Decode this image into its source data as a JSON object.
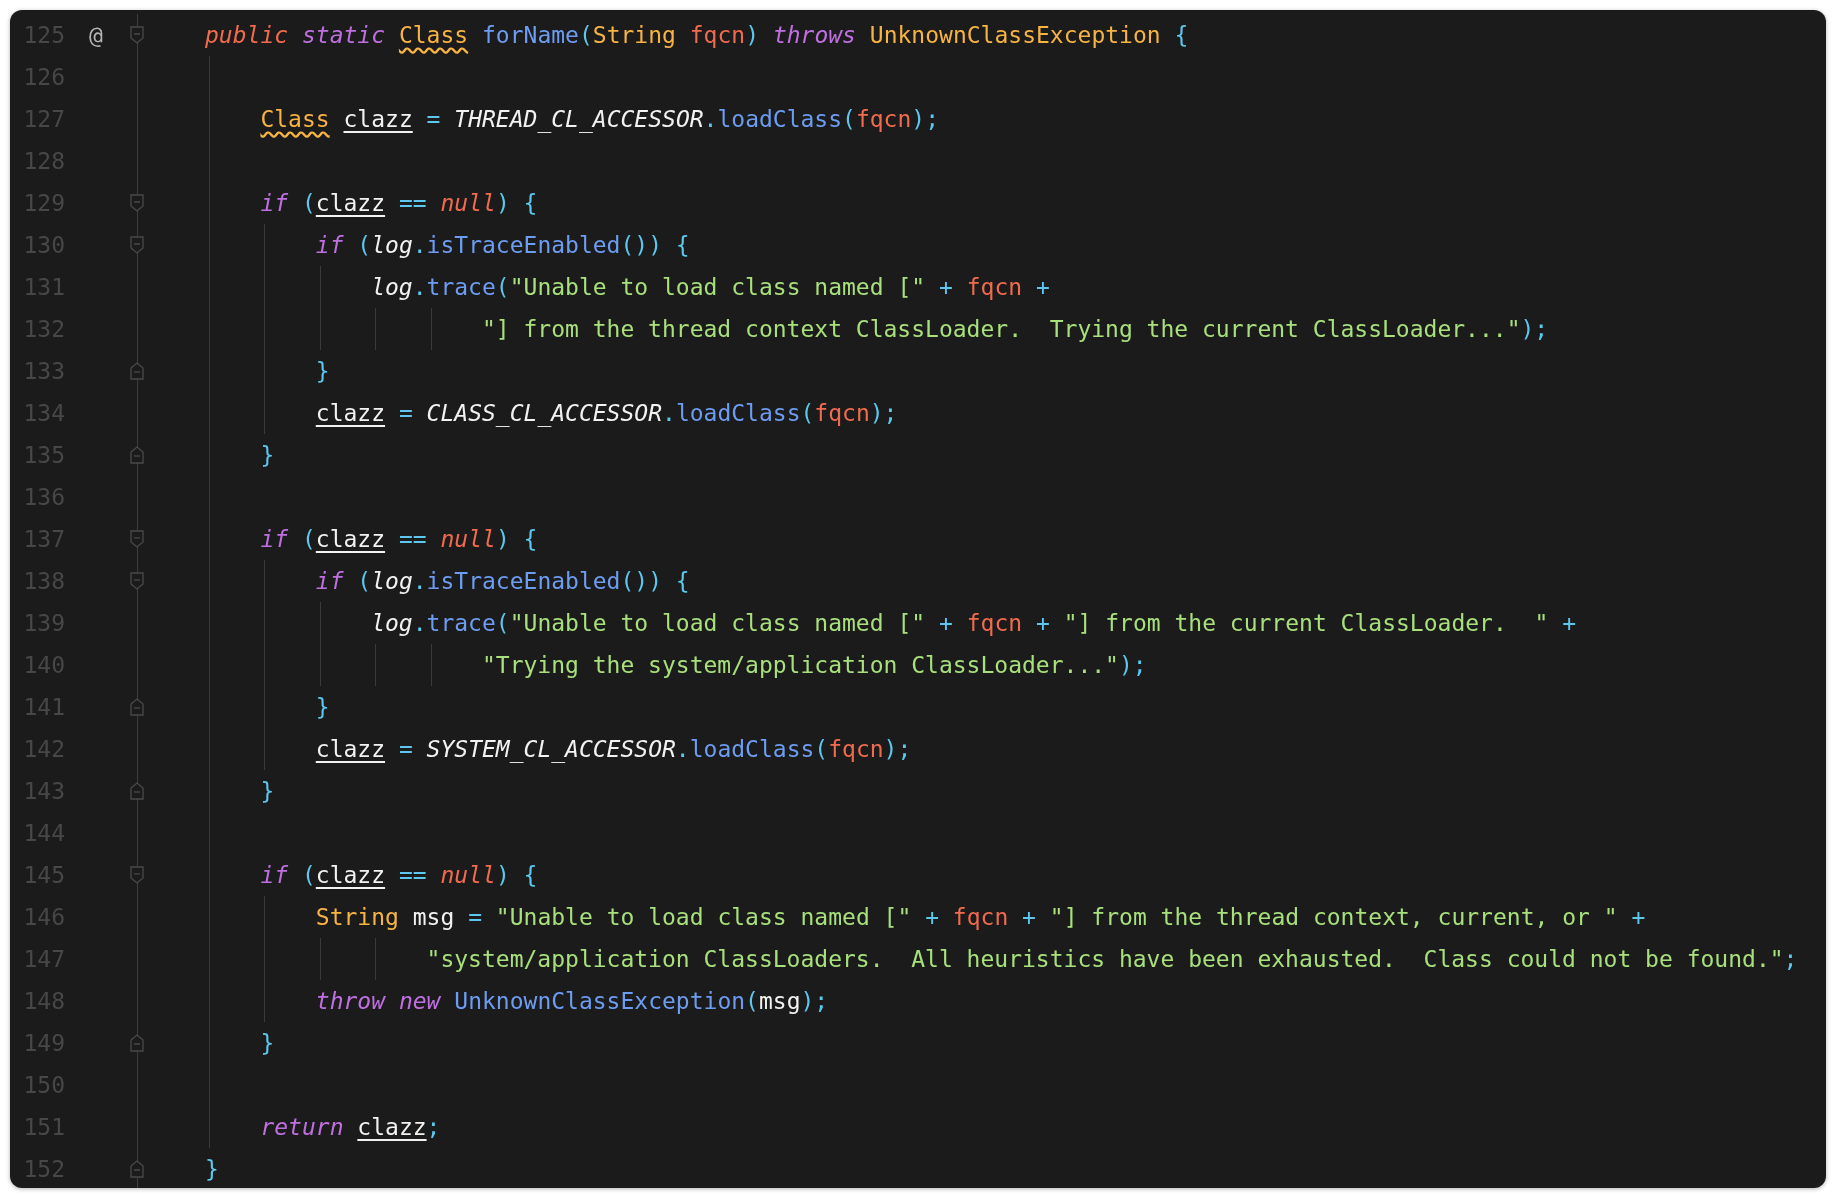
{
  "editor": {
    "lines": [
      {
        "number": "125",
        "mark": "@",
        "fold": {
          "kind": "start"
        },
        "code": [
          {
            "text": "public ",
            "kind": "modifier"
          },
          {
            "text": "static ",
            "kind": "keyword"
          },
          {
            "text": "Class ",
            "kind": "type-warning"
          },
          {
            "text": "forName",
            "kind": "function"
          },
          {
            "text": "(",
            "kind": "punct"
          },
          {
            "text": "String ",
            "kind": "type"
          },
          {
            "text": "fqcn",
            "kind": "param"
          },
          {
            "text": ") ",
            "kind": "punct"
          },
          {
            "text": "throws ",
            "kind": "keyword"
          },
          {
            "text": "UnknownClassException",
            "kind": "type"
          },
          {
            "text": " {",
            "kind": "punct"
          }
        ]
      },
      {
        "number": "126"
      },
      {
        "number": "127",
        "code": [
          {
            "text": "    Class ",
            "kind": "type-warning"
          },
          {
            "text": "clazz",
            "kind": "variable"
          },
          {
            "text": " = ",
            "kind": "punct"
          },
          {
            "text": "THREAD_CL_ACCESSOR",
            "kind": "constant"
          },
          {
            "text": ".",
            "kind": "punct"
          },
          {
            "text": "loadClass",
            "kind": "function"
          },
          {
            "text": "(",
            "kind": "punct"
          },
          {
            "text": "fqcn",
            "kind": "param"
          },
          {
            "text": ");",
            "kind": "punct"
          }
        ]
      },
      {
        "number": "128"
      },
      {
        "number": "129",
        "fold": {
          "kind": "start"
        },
        "code": [
          {
            "text": "    if",
            "kind": "keyword"
          },
          {
            "text": " (",
            "kind": "punct"
          },
          {
            "text": "clazz",
            "kind": "variable"
          },
          {
            "text": " == ",
            "kind": "punct"
          },
          {
            "text": "null",
            "kind": "modifier"
          },
          {
            "text": ") {",
            "kind": "punct"
          }
        ]
      },
      {
        "number": "130",
        "fold": {
          "kind": "start"
        },
        "code": [
          {
            "text": "        if",
            "kind": "keyword"
          },
          {
            "text": " (",
            "kind": "punct"
          },
          {
            "text": "log",
            "kind": "constant"
          },
          {
            "text": ".",
            "kind": "punct"
          },
          {
            "text": "isTraceEnabled",
            "kind": "function"
          },
          {
            "text": "()) {",
            "kind": "punct"
          }
        ]
      },
      {
        "number": "131",
        "code": [
          {
            "text": "            log",
            "kind": "constant"
          },
          {
            "text": ".",
            "kind": "punct"
          },
          {
            "text": "trace",
            "kind": "function"
          },
          {
            "text": "(",
            "kind": "punct"
          },
          {
            "text": "\"Unable to load class named [\"",
            "kind": "string"
          },
          {
            "text": " + ",
            "kind": "punct"
          },
          {
            "text": "fqcn",
            "kind": "param"
          },
          {
            "text": " +",
            "kind": "punct"
          }
        ]
      },
      {
        "number": "132",
        "code": [
          {
            "text": "                    \"] from the thread context ClassLoader.  Trying the current ClassLoader...\"",
            "kind": "string"
          },
          {
            "text": ");",
            "kind": "punct"
          }
        ]
      },
      {
        "number": "133",
        "fold": {
          "kind": "end"
        },
        "code": [
          {
            "text": "        }",
            "kind": "punct"
          }
        ]
      },
      {
        "number": "134",
        "code": [
          {
            "text": "        clazz",
            "kind": "variable"
          },
          {
            "text": " = ",
            "kind": "punct"
          },
          {
            "text": "CLASS_CL_ACCESSOR",
            "kind": "constant"
          },
          {
            "text": ".",
            "kind": "punct"
          },
          {
            "text": "loadClass",
            "kind": "function"
          },
          {
            "text": "(",
            "kind": "punct"
          },
          {
            "text": "fqcn",
            "kind": "param"
          },
          {
            "text": ");",
            "kind": "punct"
          }
        ]
      },
      {
        "number": "135",
        "fold": {
          "kind": "end"
        },
        "code": [
          {
            "text": "    }",
            "kind": "punct"
          }
        ]
      },
      {
        "number": "136"
      },
      {
        "number": "137",
        "fold": {
          "kind": "start"
        },
        "code": [
          {
            "text": "    if",
            "kind": "keyword"
          },
          {
            "text": " (",
            "kind": "punct"
          },
          {
            "text": "clazz",
            "kind": "variable"
          },
          {
            "text": " == ",
            "kind": "punct"
          },
          {
            "text": "null",
            "kind": "modifier"
          },
          {
            "text": ") {",
            "kind": "punct"
          }
        ]
      },
      {
        "number": "138",
        "fold": {
          "kind": "start"
        },
        "code": [
          {
            "text": "        if",
            "kind": "keyword"
          },
          {
            "text": " (",
            "kind": "punct"
          },
          {
            "text": "log",
            "kind": "constant"
          },
          {
            "text": ".",
            "kind": "punct"
          },
          {
            "text": "isTraceEnabled",
            "kind": "function"
          },
          {
            "text": "()) {",
            "kind": "punct"
          }
        ]
      },
      {
        "number": "139",
        "code": [
          {
            "text": "            log",
            "kind": "constant"
          },
          {
            "text": ".",
            "kind": "punct"
          },
          {
            "text": "trace",
            "kind": "function"
          },
          {
            "text": "(",
            "kind": "punct"
          },
          {
            "text": "\"Unable to load class named [\"",
            "kind": "string"
          },
          {
            "text": " + ",
            "kind": "punct"
          },
          {
            "text": "fqcn",
            "kind": "param"
          },
          {
            "text": " + ",
            "kind": "punct"
          },
          {
            "text": "\"] from the current ClassLoader.  \"",
            "kind": "string"
          },
          {
            "text": " +",
            "kind": "punct"
          }
        ]
      },
      {
        "number": "140",
        "code": [
          {
            "text": "                    \"Trying the system/application ClassLoader...\"",
            "kind": "string"
          },
          {
            "text": ");",
            "kind": "punct"
          }
        ]
      },
      {
        "number": "141",
        "fold": {
          "kind": "end"
        },
        "code": [
          {
            "text": "        }",
            "kind": "punct"
          }
        ]
      },
      {
        "number": "142",
        "code": [
          {
            "text": "        clazz",
            "kind": "variable"
          },
          {
            "text": " = ",
            "kind": "punct"
          },
          {
            "text": "SYSTEM_CL_ACCESSOR",
            "kind": "constant"
          },
          {
            "text": ".",
            "kind": "punct"
          },
          {
            "text": "loadClass",
            "kind": "function"
          },
          {
            "text": "(",
            "kind": "punct"
          },
          {
            "text": "fqcn",
            "kind": "param"
          },
          {
            "text": ");",
            "kind": "punct"
          }
        ]
      },
      {
        "number": "143",
        "fold": {
          "kind": "end"
        },
        "code": [
          {
            "text": "    }",
            "kind": "punct"
          }
        ]
      },
      {
        "number": "144"
      },
      {
        "number": "145",
        "fold": {
          "kind": "start"
        },
        "code": [
          {
            "text": "    if",
            "kind": "keyword"
          },
          {
            "text": " (",
            "kind": "punct"
          },
          {
            "text": "clazz",
            "kind": "variable"
          },
          {
            "text": " == ",
            "kind": "punct"
          },
          {
            "text": "null",
            "kind": "modifier"
          },
          {
            "text": ") {",
            "kind": "punct"
          }
        ]
      },
      {
        "number": "146",
        "code": [
          {
            "text": "        String",
            "kind": "type"
          },
          {
            "text": " msg",
            "kind": "plain"
          },
          {
            "text": " = ",
            "kind": "punct"
          },
          {
            "text": "\"Unable to load class named [\"",
            "kind": "string"
          },
          {
            "text": " + ",
            "kind": "punct"
          },
          {
            "text": "fqcn",
            "kind": "param"
          },
          {
            "text": " + ",
            "kind": "punct"
          },
          {
            "text": "\"] from the thread context, current, or \"",
            "kind": "string"
          },
          {
            "text": " +",
            "kind": "punct"
          }
        ]
      },
      {
        "number": "147",
        "code": [
          {
            "text": "                \"system/application ClassLoaders.  All heuristics have been exhausted.  Class could not be found.\"",
            "kind": "string"
          },
          {
            "text": ";",
            "kind": "punct"
          }
        ]
      },
      {
        "number": "148",
        "code": [
          {
            "text": "        throw ",
            "kind": "keyword"
          },
          {
            "text": "new ",
            "kind": "keyword"
          },
          {
            "text": "UnknownClassException",
            "kind": "function"
          },
          {
            "text": "(",
            "kind": "punct"
          },
          {
            "text": "msg",
            "kind": "plain"
          },
          {
            "text": ");",
            "kind": "punct"
          }
        ]
      },
      {
        "number": "149",
        "fold": {
          "kind": "end"
        },
        "code": [
          {
            "text": "    }",
            "kind": "punct"
          }
        ]
      },
      {
        "number": "150"
      },
      {
        "number": "151",
        "code": [
          {
            "text": "    return ",
            "kind": "keyword"
          },
          {
            "text": "clazz",
            "kind": "variable"
          },
          {
            "text": ";",
            "kind": "punct"
          }
        ]
      },
      {
        "number": "152",
        "fold": {
          "kind": "end"
        },
        "code": [
          {
            "text": "}",
            "kind": "punct"
          }
        ]
      }
    ]
  }
}
